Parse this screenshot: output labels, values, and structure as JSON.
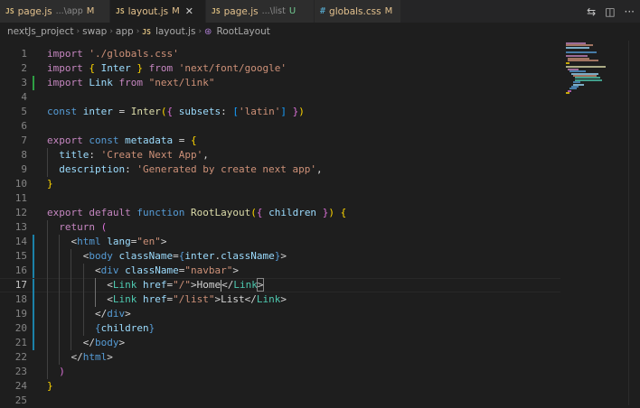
{
  "tabs": [
    {
      "lang": "JS",
      "name": "page.js",
      "desc": "...\\app",
      "badge": "M",
      "active": false
    },
    {
      "lang": "JS",
      "name": "layout.js",
      "desc": "",
      "badge": "M",
      "active": true
    },
    {
      "lang": "JS",
      "name": "page.js",
      "desc": "...\\list",
      "badge": "U",
      "active": false
    },
    {
      "lang": "#",
      "name": "globals.css",
      "desc": "",
      "badge": "M",
      "active": false
    }
  ],
  "tab_tools": {
    "compare": "⇆",
    "split": "◫",
    "more": "···"
  },
  "breadcrumb": {
    "items": [
      "nextJs_project",
      "swap",
      "app"
    ],
    "file_lang": "JS",
    "file": "layout.js",
    "symbol": "RootLayout"
  },
  "editor": {
    "current_line": 17,
    "lines": [
      {
        "n": "1"
      },
      {
        "n": "2"
      },
      {
        "n": "3"
      },
      {
        "n": "4"
      },
      {
        "n": "5"
      },
      {
        "n": "6"
      },
      {
        "n": "7"
      },
      {
        "n": "8"
      },
      {
        "n": "9"
      },
      {
        "n": "10"
      },
      {
        "n": "11"
      },
      {
        "n": "12"
      },
      {
        "n": "13"
      },
      {
        "n": "14"
      },
      {
        "n": "15"
      },
      {
        "n": "16"
      },
      {
        "n": "17"
      },
      {
        "n": "18"
      },
      {
        "n": "19"
      },
      {
        "n": "20"
      },
      {
        "n": "21"
      },
      {
        "n": "22"
      },
      {
        "n": "23"
      },
      {
        "n": "24"
      },
      {
        "n": "25"
      }
    ],
    "tokens": {
      "l1": [
        "import",
        " ",
        "'./globals.css'"
      ],
      "l2": [
        "import",
        " ",
        "{",
        " ",
        "Inter",
        " ",
        "}",
        " ",
        "from",
        " ",
        "'next/font/google'"
      ],
      "l3": [
        "import",
        " ",
        "Link",
        " ",
        "from",
        " ",
        "\"next/link\""
      ],
      "l5": [
        "const",
        " ",
        "inter",
        " = ",
        "Inter",
        "(",
        "{",
        " ",
        "subsets",
        ": ",
        "[",
        "'latin'",
        "]",
        " ",
        "}",
        ")"
      ],
      "l7": [
        "export",
        " ",
        "const",
        " ",
        "metadata",
        " = ",
        "{"
      ],
      "l8": [
        "  ",
        "title",
        ": ",
        "'Create Next App'",
        ","
      ],
      "l9": [
        "  ",
        "description",
        ": ",
        "'Generated by create next app'",
        ","
      ],
      "l10": [
        "}"
      ],
      "l12": [
        "export",
        " ",
        "default",
        " ",
        "function",
        " ",
        "RootLayout",
        "(",
        "{",
        " ",
        "children",
        " ",
        "}",
        ")",
        " ",
        "{"
      ],
      "l13": [
        "  ",
        "return",
        " ",
        "("
      ],
      "l14": [
        "    ",
        "<",
        "html",
        " ",
        "lang",
        "=",
        "\"en\"",
        ">"
      ],
      "l15": [
        "      ",
        "<",
        "body",
        " ",
        "className",
        "=",
        "{",
        "inter",
        ".",
        "className",
        "}",
        ">"
      ],
      "l16": [
        "        ",
        "<",
        "div",
        " ",
        "className",
        "=",
        "\"navbar\"",
        ">"
      ],
      "l17": [
        "          ",
        "<",
        "Link",
        " ",
        "href",
        "=",
        "\"/\"",
        ">",
        "Home",
        "",
        "</",
        "Link",
        ">"
      ],
      "l18": [
        "          ",
        "<",
        "Link",
        " ",
        "href",
        "=",
        "\"/list\"",
        ">",
        "List",
        "</",
        "Link",
        ">"
      ],
      "l19": [
        "        ",
        "</",
        "div",
        ">"
      ],
      "l20": [
        "        ",
        "{",
        "children",
        "}"
      ],
      "l21": [
        "      ",
        "</",
        "body",
        ">"
      ],
      "l22": [
        "    ",
        "</",
        "html",
        ">"
      ],
      "l23": [
        "  ",
        ")"
      ],
      "l24": [
        "}"
      ]
    }
  },
  "colors": {
    "keyword": "#c586c0",
    "string": "#ce9178",
    "variable": "#9cdcfe",
    "type": "#4ec9b0",
    "function": "#dcdcaa",
    "storage": "#569cd6",
    "git_added": "#2ea043",
    "git_modified": "#1b81a8"
  }
}
